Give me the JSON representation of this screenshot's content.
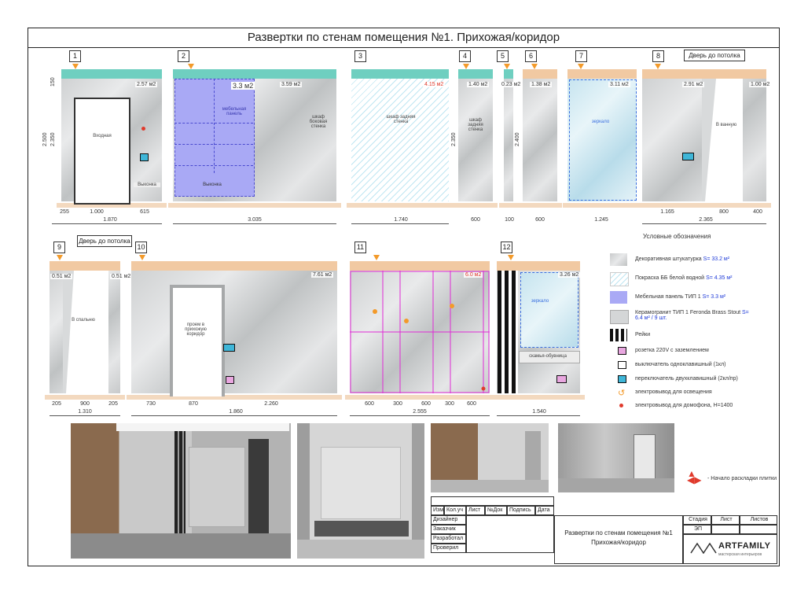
{
  "title": "Развертки по стенам помещения №1. Прихожая/коридор",
  "walls_top": [
    {
      "num": "1",
      "area": "2.57 м2"
    },
    {
      "num": "2",
      "area": "3.3 м2",
      "area2": "3.59 м2"
    },
    {
      "num": "3",
      "area": "4.15 м2"
    },
    {
      "num": "4",
      "area": "1.40 м2"
    },
    {
      "num": "5",
      "area": "0.23 м2"
    },
    {
      "num": "6",
      "area": "1.38 м2"
    },
    {
      "num": "7",
      "area": "3.11 м2"
    },
    {
      "num": "8",
      "area": "2.91 м2",
      "area2": "1.00 м2"
    }
  ],
  "walls_bottom": [
    {
      "num": "9",
      "area": "0.51 м2",
      "area2": "0.51 м2"
    },
    {
      "num": "10",
      "area": "7.61 м2"
    },
    {
      "num": "11",
      "area": "6.0 м2"
    },
    {
      "num": "12",
      "area": "3.26 м2"
    }
  ],
  "door_to_ceiling_1": "Дверь до потолка",
  "door_to_ceiling_2": "Дверь до потолка",
  "labels": {
    "vhodnaya": "Входная",
    "vykonka": "Выконка",
    "mebel_panel": "мебельная панель",
    "shkaf_back": "шкаф боковая стенка",
    "shkaf_side": "шкаф задняя стенка",
    "shkaf_side2": "шкаф задняя стенка",
    "zerkalo": "зеркало",
    "v_vannu": "В ванную",
    "v_spalnyu": "В спальню",
    "proem": "проем в прихожую коридор",
    "zerkalo2": "зеркало",
    "skameyka": "скамья-обувница"
  },
  "dims_top": [
    "1.870",
    "3.035",
    "1.740",
    "600",
    "100",
    "600",
    "1.245",
    "2.365"
  ],
  "dims_top_sub": [
    "255",
    "1.000",
    "615",
    "1.165",
    "800",
    "400"
  ],
  "dims_bottom": [
    "1.310",
    "1.860",
    "2.555",
    "1.540"
  ],
  "dims_bottom_sub": [
    "205",
    "900",
    "205",
    "730",
    "870",
    "2.260",
    "600",
    "300",
    "600",
    "300",
    "600"
  ],
  "vert_dims": [
    "2.500",
    "2.350",
    "150",
    "2.350",
    "2.400",
    "2.400",
    "2.350",
    "150"
  ],
  "legend": {
    "title": "Условные обозначения",
    "items": [
      {
        "text": "Декоративная штукатурка",
        "value": "S= 33.2 м²"
      },
      {
        "text": "Покраска ББ белой водной",
        "value": "S= 4.35 м²"
      },
      {
        "text": "Мебельная панель ТИП 1",
        "value": "S= 3.3 м²"
      },
      {
        "text": "Керамогранит ТИП 1 Feronda Brass Stout",
        "value": "S= 6.4 м² / 9 шт."
      },
      {
        "text": "Рейки",
        "value": ""
      },
      {
        "text": "розетка 220V с заземлением",
        "value": ""
      },
      {
        "text": "выключатель одноклавишный (1кл)",
        "value": ""
      },
      {
        "text": "переключатель двухклавишный (2кл/пр)",
        "value": ""
      },
      {
        "text": "электровывод для освещения",
        "value": ""
      },
      {
        "text": "электровывод для домофона, Н=1400",
        "value": ""
      }
    ],
    "start_text": "- Начало раскладки плитки"
  },
  "stamp": {
    "headers": [
      "Изм.",
      "Кол.уч",
      "Лист",
      "№Док",
      "Подпись",
      "Дата"
    ],
    "rows": [
      "Дизайнер",
      "Заказчик",
      "Разработал",
      "Проверил"
    ],
    "center": "Развертки по стенам помещения №1 Прихожая/коридор",
    "stage_h": "Стадия",
    "sheet_h": "Лист",
    "sheets_h": "Листов",
    "stage": "ЭП",
    "brand": "ARTFAMILY",
    "brand_sub": "мастерская интерьеров"
  },
  "colors": {
    "teal": "#6fcfc0",
    "orange": "#f39a2a",
    "panel": "#a9a9f5",
    "paint": "#bfe6f2",
    "tile_line": "#e02bd6",
    "red": "#e03a2c",
    "blue": "#1f3bd8"
  }
}
